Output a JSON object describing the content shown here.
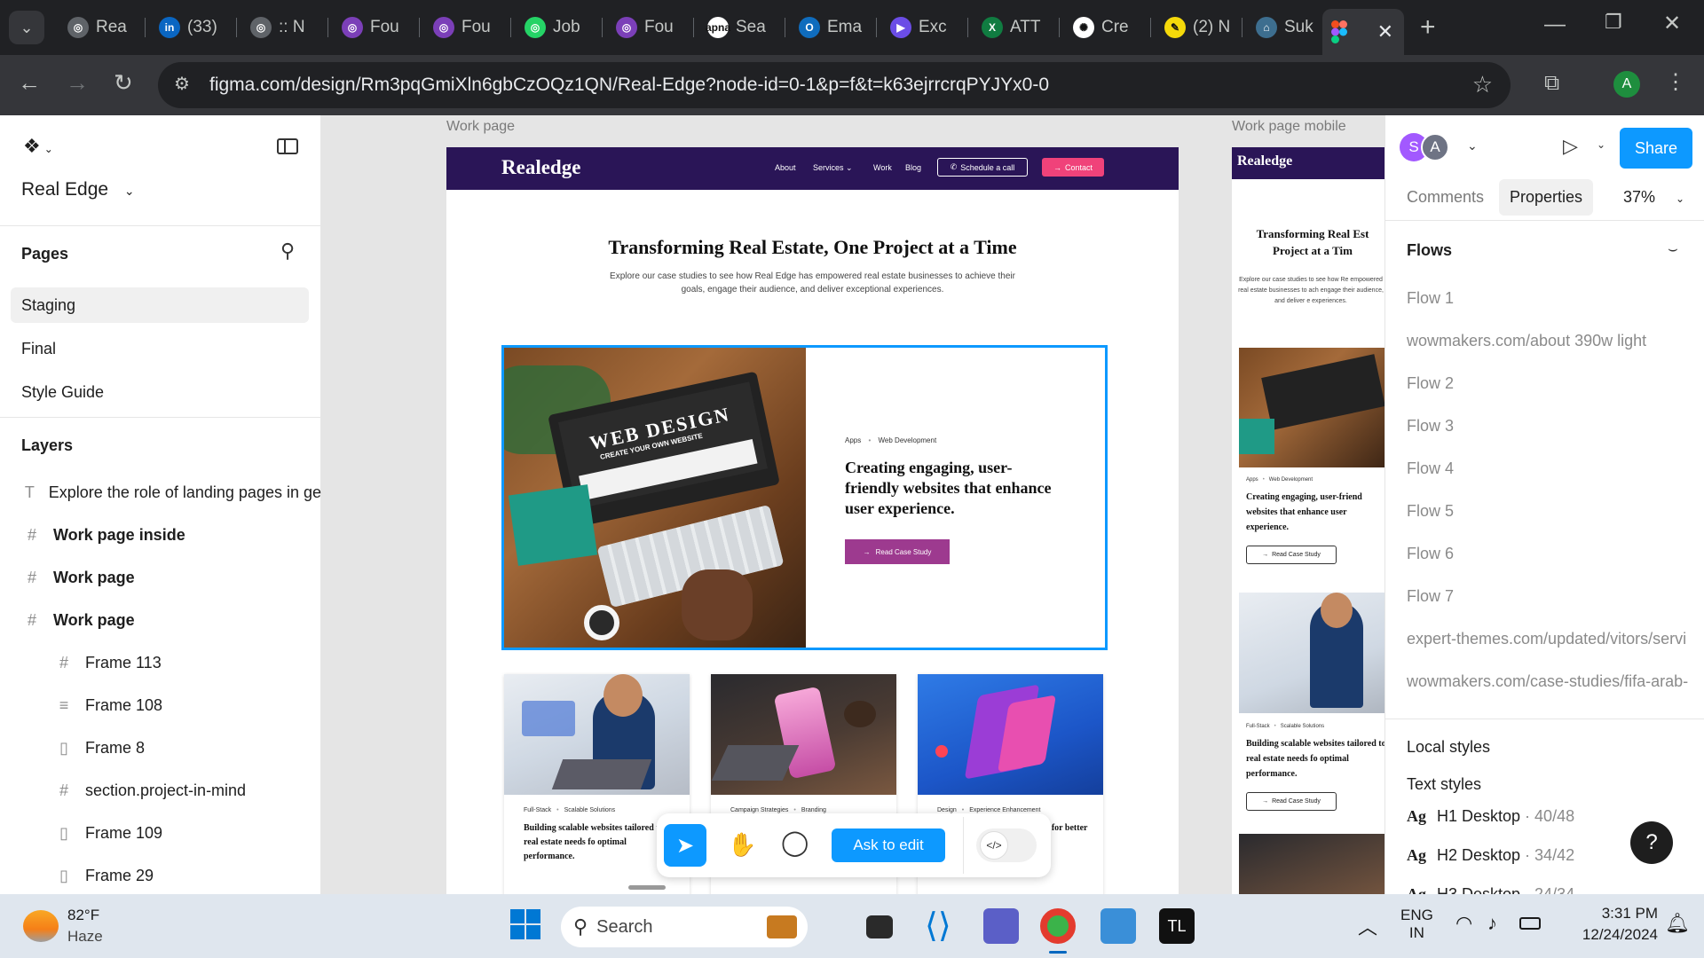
{
  "browser": {
    "tabs": [
      {
        "label": "Rea",
        "color": "#5f6368",
        "glyph": "◎"
      },
      {
        "label": "(33)",
        "color": "#0a66c2",
        "glyph": "in"
      },
      {
        "label": ":: N",
        "color": "#5f6368",
        "glyph": "◎"
      },
      {
        "label": "Fou",
        "color": "#7b3fb8",
        "glyph": "◎"
      },
      {
        "label": "Fou",
        "color": "#7b3fb8",
        "glyph": "◎"
      },
      {
        "label": "Job",
        "color": "#25d366",
        "glyph": "◎"
      },
      {
        "label": "Fou",
        "color": "#7b3fb8",
        "glyph": "◎"
      },
      {
        "label": "Sea",
        "color": "#ffffff",
        "glyph": "apna"
      },
      {
        "label": "Ema",
        "color": "#0f6cbd",
        "glyph": "O"
      },
      {
        "label": "Exc",
        "color": "#6b4de6",
        "glyph": "▶"
      },
      {
        "label": "ATT",
        "color": "#107c41",
        "glyph": "X"
      },
      {
        "label": "Cre",
        "color": "#ffffff",
        "glyph": "✺"
      },
      {
        "label": "(2) N",
        "color": "#f5d90a",
        "glyph": "✎"
      },
      {
        "label": "Suk",
        "color": "#3d6e8f",
        "glyph": "⌂"
      }
    ],
    "active_tab_icon": "figma-icon",
    "url": "figma.com/design/Rm3pqGmiXln6gbCzOQz1QN/Real-Edge?node-id=0-1&p=f&t=k63ejrrcrqPYJYx0-0",
    "profile_initial": "A"
  },
  "figma": {
    "file_name": "Real Edge",
    "pages_heading": "Pages",
    "pages": [
      "Staging",
      "Final",
      "Style Guide"
    ],
    "layers_heading": "Layers",
    "layers": [
      {
        "icon": "T",
        "label": "Explore the role of landing pages in ge",
        "bold": false,
        "indent": 0
      },
      {
        "icon": "#",
        "label": "Work page inside",
        "bold": true,
        "indent": 0
      },
      {
        "icon": "#",
        "label": "Work page",
        "bold": true,
        "indent": 0
      },
      {
        "icon": "#",
        "label": "Work page",
        "bold": true,
        "indent": 0
      },
      {
        "icon": "#",
        "label": "Frame 113",
        "bold": false,
        "indent": 1
      },
      {
        "icon": "≡",
        "label": "Frame 108",
        "bold": false,
        "indent": 1
      },
      {
        "icon": "▯",
        "label": "Frame 8",
        "bold": false,
        "indent": 1
      },
      {
        "icon": "#",
        "label": "section.project-in-mind",
        "bold": false,
        "indent": 1
      },
      {
        "icon": "▯",
        "label": "Frame 109",
        "bold": false,
        "indent": 1
      },
      {
        "icon": "▯",
        "label": "Frame 29",
        "bold": false,
        "indent": 1
      }
    ],
    "canvas": {
      "frame1_label": "Work page",
      "frame2_label": "Work page mobile"
    },
    "site": {
      "logo": "Realedge",
      "nav": [
        "About",
        "Services",
        "Work",
        "Blog"
      ],
      "schedule_btn": "Schedule a call",
      "contact_btn": "Contact",
      "hero_title": "Transforming Real Estate, One Project at a Time",
      "hero_sub": "Explore our case studies to see how Real Edge has empowered real estate businesses to achieve their goals, engage their audience, and deliver exceptional experiences.",
      "featured_tags": [
        "Apps",
        "Web Development"
      ],
      "featured_title": "Creating engaging, user-friendly websites that enhance user experience.",
      "featured_btn": "Read Case Study",
      "web_design_line1": "WEB DESIGN",
      "web_design_line2": "CREATE YOUR OWN WEBSITE",
      "cards": [
        {
          "tags": [
            "Full-Stack",
            "Scalable Solutions"
          ],
          "title": "Building scalable websites tailored to real estate needs fo optimal performance."
        },
        {
          "tags": [
            "Campaign Strategies",
            "Branding"
          ],
          "title": ""
        },
        {
          "tags": [
            "Design",
            "Experience Enhancement"
          ],
          "title": "es for better"
        }
      ],
      "mobile_title": "Transforming Real Est Project at a Tim",
      "mobile_sub": "Explore our case studies to see how Re empowered real estate businesses to ach engage their audience, and deliver e experiences.",
      "mobile_card1_tags": [
        "Apps",
        "Web Development"
      ],
      "mobile_card1_title": "Creating engaging, user-friend websites that enhance user experience.",
      "mobile_card2_tags": [
        "Full-Stack",
        "Scalable Solutions"
      ],
      "mobile_card2_title": "Building scalable websites tailored to real estate needs fo optimal performance.",
      "mobile_btn": "Read Case Study"
    },
    "toolbar": {
      "ask_to_edit": "Ask to edit"
    },
    "right": {
      "avatars": [
        "S",
        "A"
      ],
      "share": "Share",
      "tab_comments": "Comments",
      "tab_properties": "Properties",
      "zoom": "37%",
      "flows_heading": "Flows",
      "flows": [
        "Flow 1",
        "wowmakers.com/about 390w light",
        "Flow 2",
        "Flow 3",
        "Flow 4",
        "Flow 5",
        "Flow 6",
        "Flow 7",
        "expert-themes.com/updated/vitors/servi",
        "wowmakers.com/case-studies/fifa-arab-"
      ],
      "local_styles": "Local styles",
      "text_styles": "Text styles",
      "styles": [
        {
          "name": "H1 Desktop",
          "size": "40/48"
        },
        {
          "name": "H2 Desktop",
          "size": "34/42"
        },
        {
          "name": "H3 Desktop",
          "size": "24/34"
        }
      ],
      "help": "?"
    }
  },
  "taskbar": {
    "temp": "82°F",
    "weather": "Haze",
    "search": "Search",
    "lang1": "ENG",
    "lang2": "IN",
    "time": "3:31 PM",
    "date": "12/24/2024"
  },
  "colors": {
    "figma_blue": "#0d99ff",
    "site_purple": "#2a1557",
    "contact_pink": "#f0427a",
    "read_btn": "#9d3a8f"
  }
}
